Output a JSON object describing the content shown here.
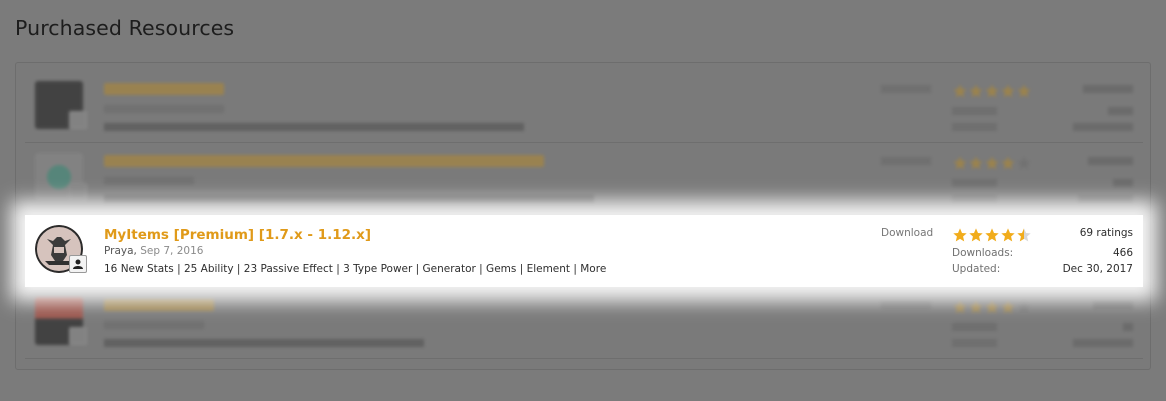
{
  "page": {
    "title": "Purchased Resources"
  },
  "colors": {
    "accent": "#e09a19",
    "star": "#f1ac1b",
    "overlay": "#7b7b7b"
  },
  "resources": [
    {
      "title": "",
      "author": "",
      "date": "",
      "description": "",
      "download_label": "Download",
      "ratings": "",
      "downloads_label": "",
      "downloads": "",
      "updated_label": "",
      "updated": "",
      "stars": 4.5,
      "icon": "dark-square-icon"
    },
    {
      "title": "",
      "author": "",
      "date": "",
      "description": "",
      "download_label": "Download",
      "ratings": "",
      "downloads_label": "",
      "downloads": "",
      "updated_label": "",
      "updated": "",
      "stars": 4,
      "icon": "green-cube-icon"
    },
    {
      "title": "MyItems [Premium] [1.7.x - 1.12.x]",
      "author": "Praya",
      "date": "Sep 7, 2016",
      "description": "16 New Stats | 25 Ability | 23 Passive Effect | 3 Type Power | Generator | Gems | Element | More",
      "download_label": "Download",
      "ratings": "69 ratings",
      "downloads_label": "Downloads:",
      "downloads": "466",
      "updated_label": "Updated:",
      "updated": "Dec 30, 2017",
      "stars": 4.5,
      "icon": "knight-emblem-icon"
    },
    {
      "title": "",
      "author": "",
      "date": "",
      "description": "",
      "download_label": "Download",
      "ratings": "",
      "downloads_label": "",
      "downloads": "",
      "updated_label": "",
      "updated": "",
      "stars": 4,
      "icon": "red-block-icon"
    }
  ]
}
